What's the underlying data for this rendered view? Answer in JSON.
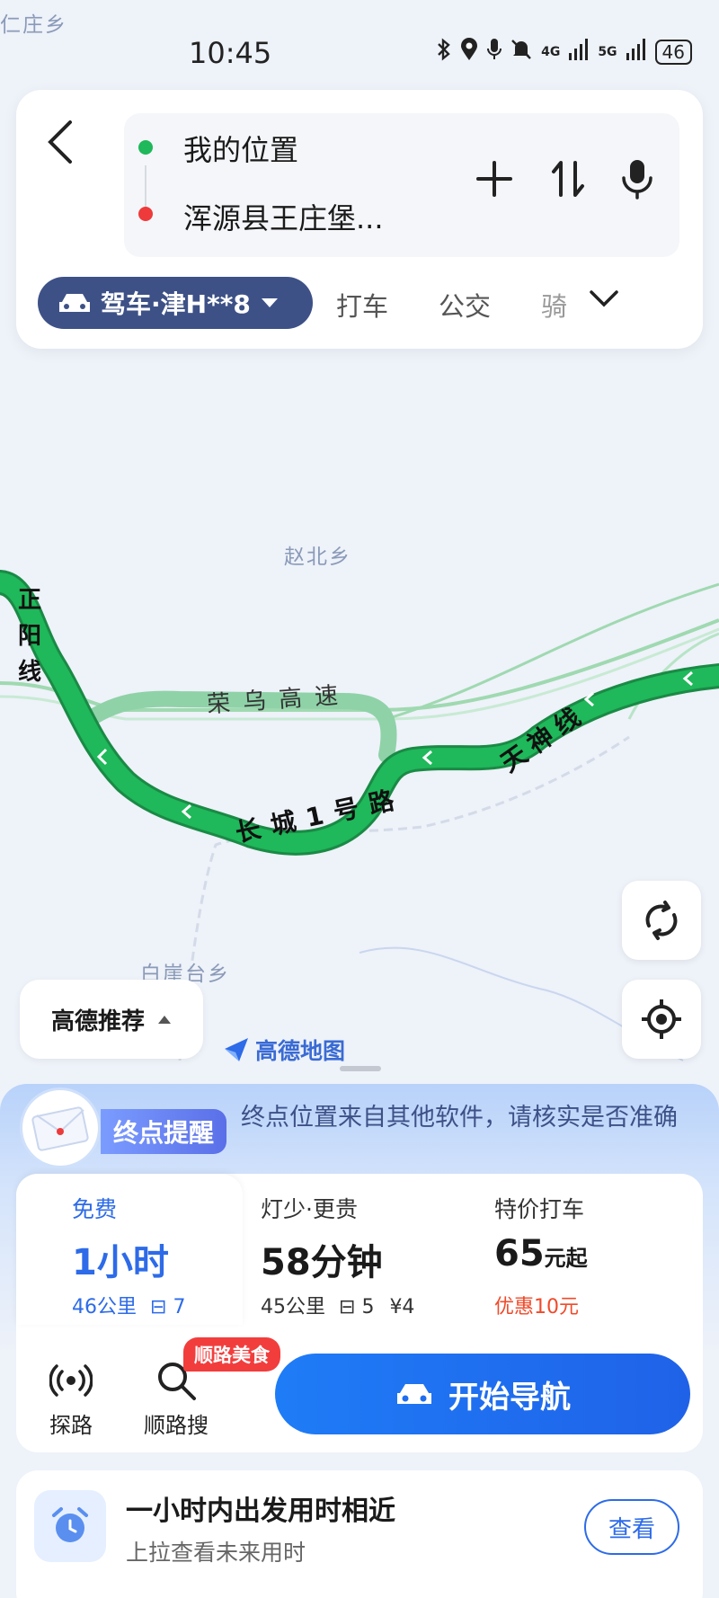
{
  "status": {
    "time": "10:45",
    "net1": "4G",
    "net2": "5G",
    "battery": "46"
  },
  "map": {
    "place_top": "仁庄乡",
    "place_zhaobei": "赵北乡",
    "place_baiyatai": "白崖台乡",
    "road_zhengyang": "正阳线",
    "road_rongwu": "荣乌高速",
    "road_changcheng": "长城1号路",
    "road_tianshen": "天神线",
    "logo": "高德地图"
  },
  "route": {
    "origin": "我的位置",
    "destination": "浑源县王庄堡..."
  },
  "modes": {
    "active": "驾车·津H**8",
    "taxi": "打车",
    "bus": "公交",
    "ride": "骑"
  },
  "recommend": {
    "label": "高德推荐"
  },
  "alert": {
    "tag": "终点提醒",
    "text": "终点位置来自其他软件，请核实是否准确"
  },
  "options": [
    {
      "label": "免费",
      "time": "1小时",
      "dist": "46公里",
      "lights": "7"
    },
    {
      "label": "灯少·更贵",
      "time": "58分钟",
      "dist": "45公里",
      "lights": "5",
      "fee": "¥4"
    },
    {
      "label": "特价打车",
      "price": "65",
      "price_unit": "元起",
      "promo": "优惠10元"
    }
  ],
  "tools": {
    "explore": "探路",
    "search": "顺路搜",
    "food_badge": "顺路美食"
  },
  "nav": {
    "start": "开始导航"
  },
  "hint": {
    "title": "一小时内出发用时相近",
    "sub": "上拉查看未来用时",
    "view": "查看"
  },
  "colors": {
    "route_green": "#1fb85a",
    "accent_blue": "#2d6be8",
    "mode_navy": "#3d5187",
    "promo_red": "#f04a2a"
  }
}
